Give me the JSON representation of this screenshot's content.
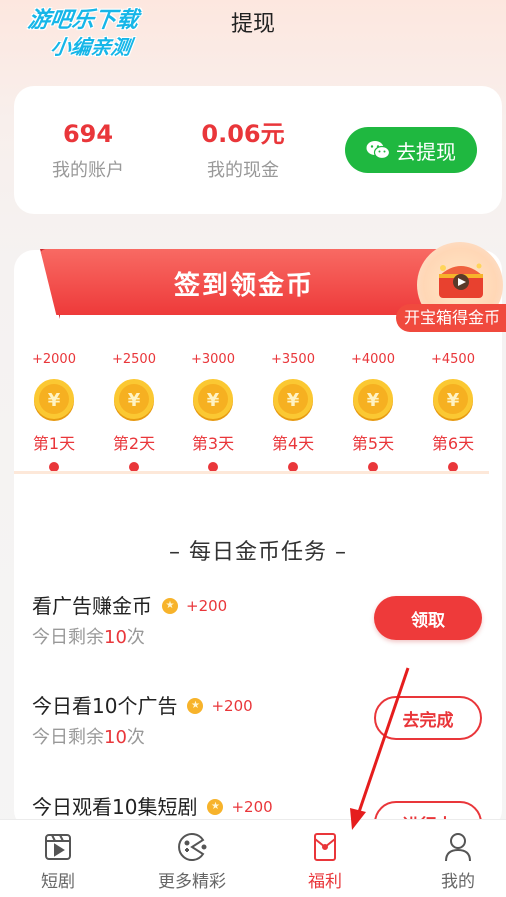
{
  "watermark": {
    "line1": "游吧乐下载",
    "line2": "小编亲测"
  },
  "page": {
    "title": "提现"
  },
  "account": {
    "balance_value": "694",
    "balance_label": "我的账户",
    "cash_value": "0.06元",
    "cash_label": "我的现金",
    "withdraw_label": "去提现"
  },
  "checkin": {
    "title": "签到领金币",
    "treasure_label": "开宝箱得金币",
    "days": [
      {
        "reward": "+2000",
        "label": "第1天"
      },
      {
        "reward": "+2500",
        "label": "第2天"
      },
      {
        "reward": "+3000",
        "label": "第3天"
      },
      {
        "reward": "+3500",
        "label": "第4天"
      },
      {
        "reward": "+4000",
        "label": "第5天"
      },
      {
        "reward": "+4500",
        "label": "第6天"
      }
    ]
  },
  "tasks": {
    "header": "– 每日金币任务 –",
    "items": [
      {
        "name": "看广告赚金币",
        "reward": "+200",
        "remain_prefix": "今日剩余",
        "remain_count": "10",
        "remain_suffix": "次",
        "button": "领取"
      },
      {
        "name": "今日看10个广告",
        "reward": "+200",
        "remain_prefix": "今日剩余",
        "remain_count": "10",
        "remain_suffix": "次",
        "button": "去完成"
      },
      {
        "name": "今日观看10集短剧",
        "reward": "+200",
        "button": "进行中"
      }
    ]
  },
  "nav": {
    "items": [
      {
        "label": "短剧",
        "icon": "video-clapper-icon"
      },
      {
        "label": "更多精彩",
        "icon": "game-pacman-icon"
      },
      {
        "label": "福利",
        "icon": "red-envelope-icon"
      },
      {
        "label": "我的",
        "icon": "person-icon"
      }
    ],
    "active_index": 2
  },
  "colors": {
    "accent_red": "#e9363a",
    "wechat_green": "#1fb840",
    "coin_gold": "#f7b32b"
  }
}
